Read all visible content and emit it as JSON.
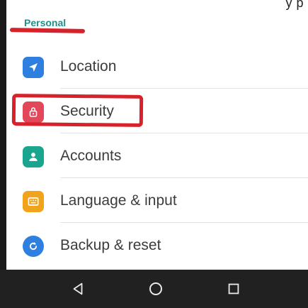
{
  "top_fragment": "y p",
  "section": {
    "title": "Personal"
  },
  "items": [
    {
      "label": "Location",
      "icon": "location-arrow-icon",
      "color": "#2f7fe0"
    },
    {
      "label": "Security",
      "icon": "lock-icon",
      "color": "#e2475a"
    },
    {
      "label": "Accounts",
      "icon": "account-icon",
      "color": "#1aa58e"
    },
    {
      "label": "Language & input",
      "icon": "keyboard-icon",
      "color": "#f2a31c"
    },
    {
      "label": "Backup & reset",
      "icon": "backup-restore-icon",
      "color": "#2f7fe0"
    }
  ],
  "annotation": {
    "color": "#d6222a",
    "target": "Security"
  },
  "navbar": {
    "background": "#212121",
    "buttons": [
      "back-icon",
      "home-icon",
      "recents-icon"
    ]
  }
}
